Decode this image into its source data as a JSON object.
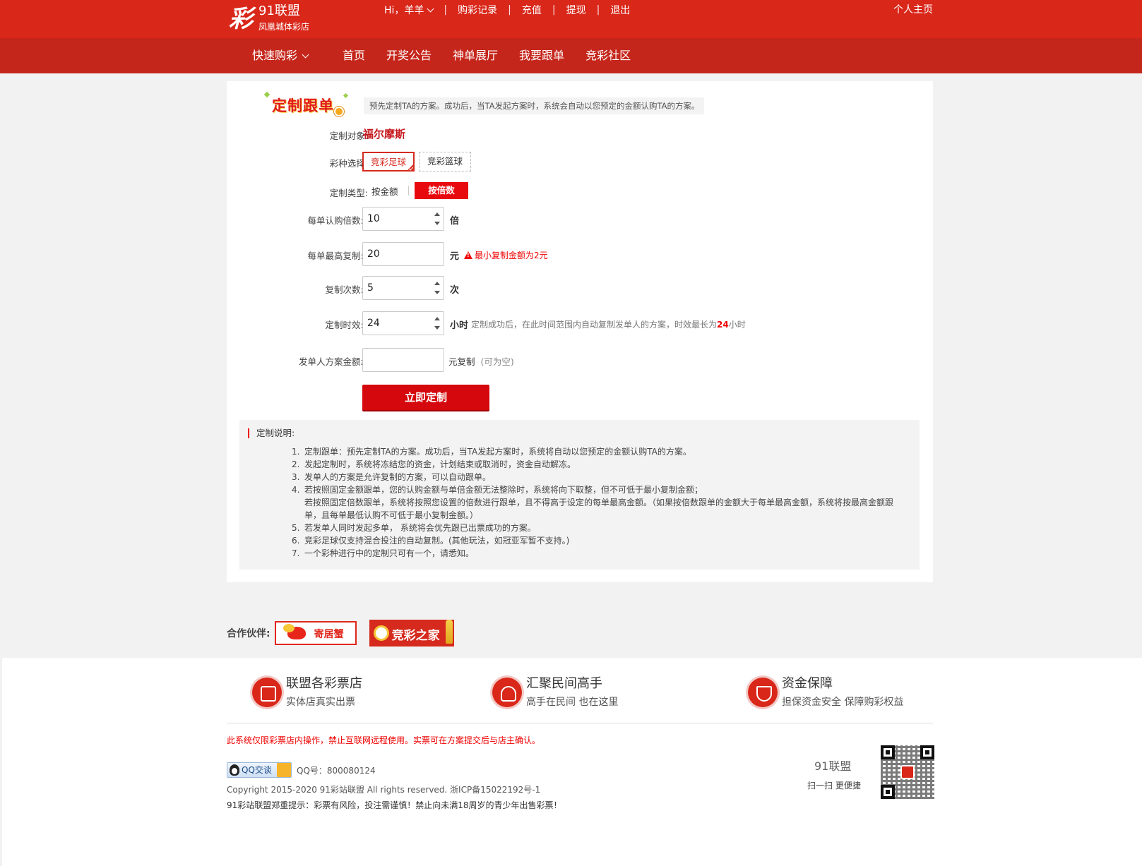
{
  "header": {
    "logo_mark": "彩",
    "logo_name": "91联盟",
    "logo_sub": "凤凰城体彩店",
    "user_greeting": "Hi，羊羊",
    "links": [
      "购彩记录",
      "充值",
      "提现",
      "退出"
    ],
    "home_link": "个人主页",
    "quick_buy": "快速购彩",
    "nav": [
      "首页",
      "开奖公告",
      "神单展厅",
      "我要跟单",
      "竞彩社区"
    ]
  },
  "banner": {
    "title": "定制跟单",
    "description": "预先定制TA的方案。成功后，当TA发起方案时，系统会自动以您预定的金额认购TA的方案。"
  },
  "form": {
    "target_label": "定制对象:",
    "target_value": "福尔摩斯",
    "lottery_label": "彩种选择:",
    "lottery_options": [
      "竞彩足球",
      "竞彩篮球"
    ],
    "lottery_selected": "竞彩足球",
    "type_label": "定制类型:",
    "type_options": [
      "按金额",
      "按倍数"
    ],
    "type_selected": "按倍数",
    "multiple_label": "每单认购倍数:",
    "multiple_value": "10",
    "multiple_unit": "倍",
    "max_label": "每单最高复制:",
    "max_value": "20",
    "max_unit": "元",
    "max_warning": "最小复制金额为2元",
    "times_label": "复制次数:",
    "times_value": "5",
    "times_unit": "次",
    "duration_label": "定制时效:",
    "duration_value": "24",
    "duration_unit": "小时",
    "duration_hint_pre": "定制成功后，在此时间范围内自动复制发单人的方案，时效最长为",
    "duration_hint_num": "24",
    "duration_hint_post": "小时",
    "amount_label": "发单人方案金额≥",
    "amount_value": "",
    "amount_unit": "元复制",
    "amount_hint": "(可为空)",
    "required_mark": "*",
    "submit_label": "立即定制"
  },
  "notes": {
    "title": "定制说明:",
    "items": [
      {
        "num": "1.",
        "text": "定制跟单：预先定制TA的方案。成功后，当TA发起方案时，系统将自动以您预定的金额认购TA的方案。"
      },
      {
        "num": "2.",
        "text": "发起定制时，系统将冻结您的资金，计划结束或取消时，资金自动解冻。"
      },
      {
        "num": "3.",
        "text": "发单人的方案是允许复制的方案，可以自动跟单。"
      },
      {
        "num": "4.",
        "text": "若按照固定金额跟单，您的认购金额与单倍金额无法整除时，系统将向下取整，但不可低于最小复制金额；"
      },
      {
        "num": "",
        "text": "若按照固定倍数跟单，系统将按照您设置的倍数进行跟单，且不得高于设定的每单最高金额。（如果按倍数跟单的金额大于每单最高金额，系统将按最高金额跟单，且每单最低认购不可低于最小复制金额。）"
      },
      {
        "num": "5.",
        "text": "若发单人同时发起多单，  系统将会优先跟已出票成功的方案。"
      },
      {
        "num": "6.",
        "text": "竞彩足球仅支持混合投注的自动复制。(其他玩法，如冠亚军暂不支持。)"
      },
      {
        "num": "7.",
        "text": "一个彩种进行中的定制只可有一个，请悉知。"
      }
    ]
  },
  "partners": {
    "label": "合作伙伴:",
    "items": [
      "寄居蟹",
      "竞彩之家"
    ]
  },
  "footer": {
    "features": [
      {
        "title": "联盟各彩票店",
        "sub": "实体店真实出票",
        "icon": "store-icon"
      },
      {
        "title": "汇聚民间高手",
        "sub": "高手在民间 也在这里",
        "icon": "user-icon"
      },
      {
        "title": "资金保障",
        "sub": "担保资金安全 保障购彩权益",
        "icon": "shield-icon"
      }
    ],
    "warning": "此系统仅限彩票店内操作，禁止互联网远程使用。实票可在方案提交后与店主确认。",
    "qq_badge": "QQ交谈",
    "qq_number": "QQ号：800080124",
    "copyright": "Copyright 2015-2020 91彩站联盟 All rights reserved. 浙ICP备15022192号-1",
    "risk_notice": "91彩站联盟郑重提示：彩票有风险，投注需谨慎！禁止向未满18周岁的青少年出售彩票！",
    "qr_brand": "91联盟",
    "qr_hint": "扫一扫 更便捷"
  },
  "colors": {
    "primary_red": "#d9271a",
    "nav_red": "#c5261b",
    "accent_red": "#e8090f"
  }
}
